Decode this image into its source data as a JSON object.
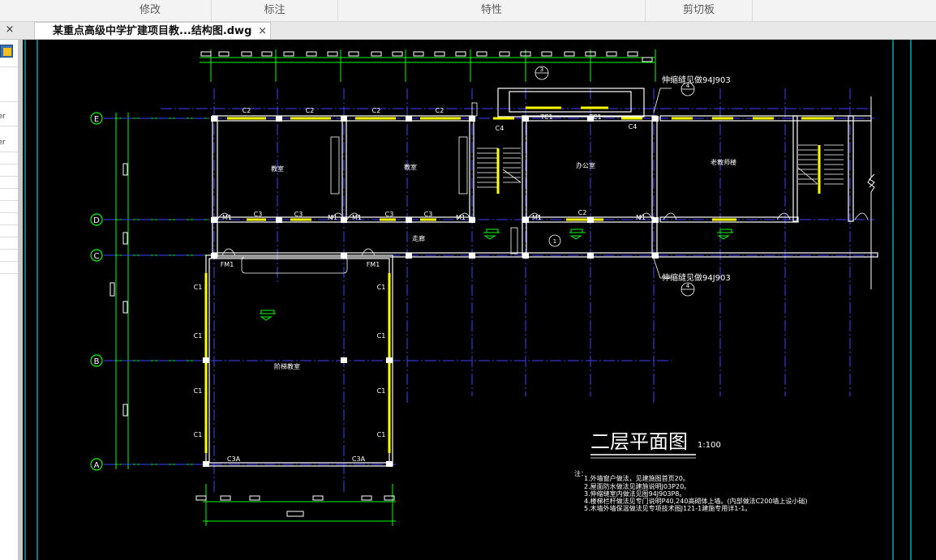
{
  "ribbon": {
    "panels": [
      "修改",
      "标注",
      "特性",
      "剪切板"
    ]
  },
  "tabs": {
    "document_title": "某重点高级中学扩建项目教...结构图.dwg",
    "close_glyph": "×"
  },
  "left_panel": {
    "fragments": [
      "ver",
      "ver"
    ]
  },
  "drawing": {
    "title": "二层平面图",
    "scale": "1:100",
    "axis_rows": [
      "E",
      "D",
      "C",
      "B",
      "A"
    ],
    "rooms": [
      "教室",
      "教室",
      "办公室",
      "老教师楼",
      "走廊",
      "阶梯教室"
    ],
    "window_labels": [
      "C2",
      "C2",
      "C2",
      "C2",
      "C4",
      "TC1",
      "TC1",
      "C4",
      "C3",
      "C3",
      "C3",
      "C3",
      "C2",
      "M1",
      "M1",
      "M1",
      "M1",
      "M1",
      "M1",
      "FM1",
      "FM1",
      "C1",
      "C1",
      "C1",
      "C1",
      "C1",
      "C1",
      "C1",
      "C1",
      "C3A",
      "C3A"
    ],
    "callouts": [
      "伸缩缝见做94J903",
      "伸缩缝见做94J903"
    ],
    "callout_refs": [
      "3",
      "4"
    ],
    "circle_marks": [
      "1",
      "1"
    ],
    "notes": [
      "注：",
      "1.外墙窗户做法，见建施图首页20。",
      "2.屋面防水做法见建施说明J03P20。",
      "3.伸缩缝室内做法见图94J903P8。",
      "4.楼梯栏杆做法见专门说明P40,240高砌体上墙。(内部做法C200墙上设小础)",
      "5.木墙外墙保温做法见专项技术图J121-1建施专用详1-1。"
    ]
  }
}
